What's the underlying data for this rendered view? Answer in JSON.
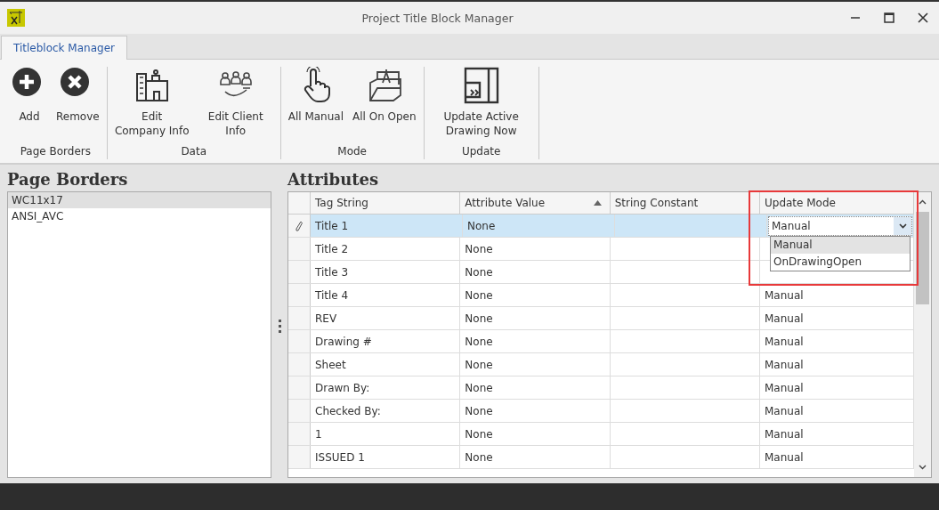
{
  "window": {
    "title": "Project Title Block Manager"
  },
  "tabs": [
    {
      "label": "Titleblock Manager",
      "selected": true
    }
  ],
  "ribbon": {
    "groups": [
      {
        "label": "Page Borders",
        "buttons": [
          {
            "label": "Add"
          },
          {
            "label": "Remove"
          }
        ]
      },
      {
        "label": "Data",
        "buttons": [
          {
            "label": "Edit Company Info"
          },
          {
            "label": "Edit Client Info"
          }
        ]
      },
      {
        "label": "Mode",
        "buttons": [
          {
            "label": "All Manual"
          },
          {
            "label": "All On Open"
          }
        ]
      },
      {
        "label": "Update",
        "buttons": [
          {
            "label": "Update Active Drawing Now"
          }
        ]
      }
    ]
  },
  "page_borders": {
    "title": "Page Borders",
    "items": [
      {
        "label": "WC11x17",
        "selected": true
      },
      {
        "label": "ANSI_AVC",
        "selected": false
      }
    ]
  },
  "attributes": {
    "title": "Attributes",
    "columns": [
      {
        "label": "Tag String",
        "sorted": false
      },
      {
        "label": "Attribute Value",
        "sorted": true
      },
      {
        "label": "String Constant",
        "sorted": false
      },
      {
        "label": "Update Mode",
        "sorted": false
      }
    ],
    "rows": [
      {
        "tag": "Title 1",
        "value": "None",
        "mode": "Manual",
        "selected": true
      },
      {
        "tag": "Title 2",
        "value": "None",
        "selected": false
      },
      {
        "tag": "Title 3",
        "value": "None",
        "selected": false
      },
      {
        "tag": "Title 4",
        "value": "None",
        "mode": "Manual",
        "selected": false
      },
      {
        "tag": "REV",
        "value": "None",
        "mode": "Manual",
        "selected": false
      },
      {
        "tag": "Drawing #",
        "value": "None",
        "mode": "Manual",
        "selected": false
      },
      {
        "tag": "Sheet",
        "value": "None",
        "mode": "Manual",
        "selected": false
      },
      {
        "tag": "Drawn By:",
        "value": "None",
        "mode": "Manual",
        "selected": false
      },
      {
        "tag": "Checked By:",
        "value": "None",
        "mode": "Manual",
        "selected": false
      },
      {
        "tag": "1",
        "value": "None",
        "mode": "Manual",
        "selected": false
      },
      {
        "tag": "ISSUED 1",
        "value": "None",
        "mode": "Manual",
        "selected": false
      }
    ],
    "dropdown_options": [
      {
        "label": "Manual",
        "selected": true
      },
      {
        "label": "OnDrawingOpen",
        "selected": false
      }
    ]
  }
}
